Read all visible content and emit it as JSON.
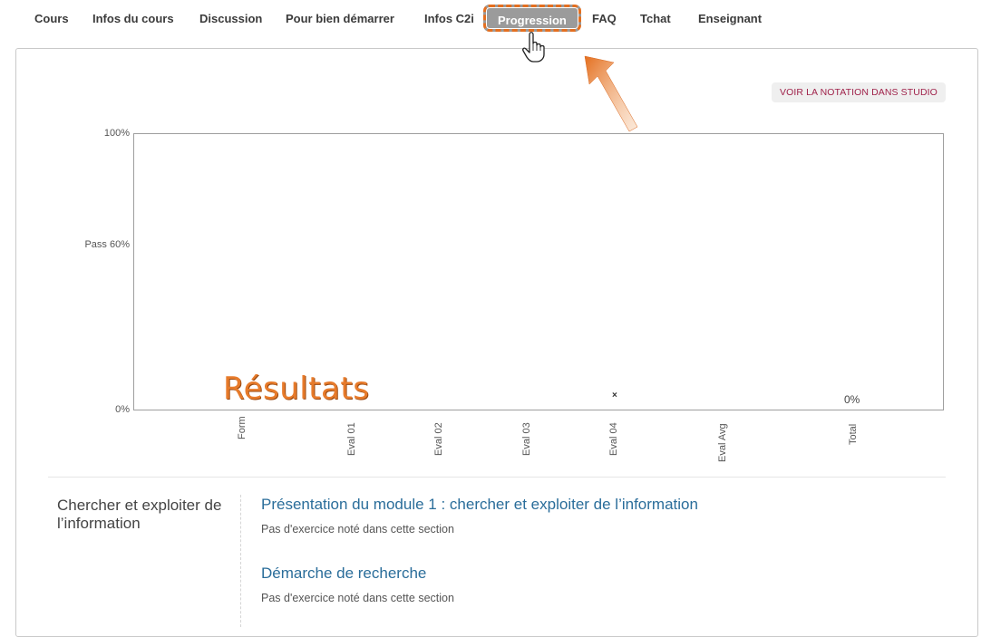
{
  "nav": {
    "tabs": [
      {
        "label": "Cours"
      },
      {
        "label": "Infos du cours"
      },
      {
        "label": "Discussion"
      },
      {
        "label": "Pour bien démarrer"
      },
      {
        "label": "Infos C2i"
      },
      {
        "label": "Progression",
        "active": true
      },
      {
        "label": "FAQ"
      },
      {
        "label": "Tchat"
      },
      {
        "label": "Enseignant"
      }
    ]
  },
  "studio_button": {
    "label": "VOIR LA NOTATION DANS STUDIO"
  },
  "annotation": {
    "label": "Résultats",
    "color": "#e77b2b"
  },
  "chart_data": {
    "type": "bar",
    "categories": [
      "Form",
      "Eval 01",
      "Eval 02",
      "Eval 03",
      "Eval 04",
      "Eval Avg",
      "Total"
    ],
    "values": [
      0,
      0,
      0,
      0,
      0,
      0,
      0
    ],
    "ylim": [
      0,
      100
    ],
    "yticks": [
      "0%",
      "Pass 60%",
      "100%"
    ],
    "pass_threshold": 60,
    "markers": [
      {
        "category": "Eval 04",
        "symbol": "×"
      }
    ],
    "data_labels": [
      {
        "category": "Total",
        "text": "0%"
      }
    ]
  },
  "sections": [
    {
      "title": "Chercher et exploiter de l’information",
      "subsections": [
        {
          "title": "Présentation du module 1 : chercher et exploiter de l’information",
          "note": "Pas d'exercice noté dans cette section"
        },
        {
          "title": "Démarche de recherche",
          "note": "Pas d'exercice noté dans cette section"
        }
      ]
    }
  ]
}
